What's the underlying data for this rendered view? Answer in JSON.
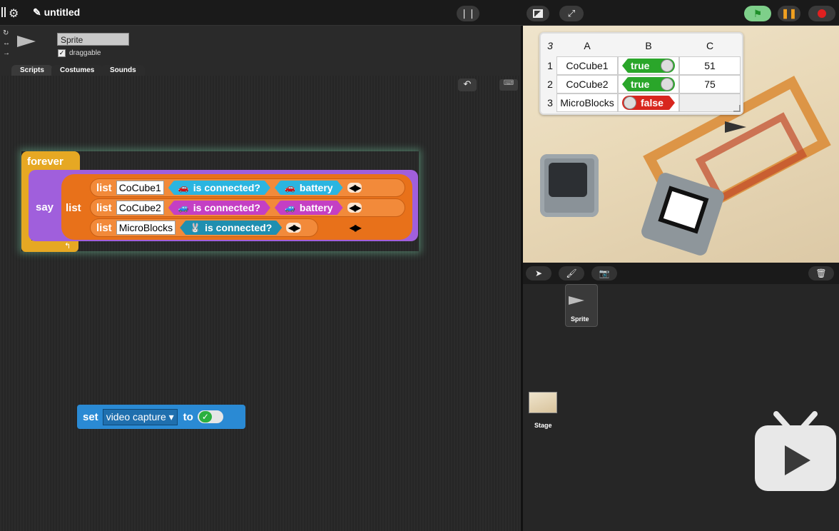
{
  "app": {
    "project_title": "✎ untitled"
  },
  "sprite": {
    "name": "Sprite",
    "draggable_label": "draggable",
    "draggable_checked": "✓"
  },
  "tabs": [
    {
      "label": "Scripts"
    },
    {
      "label": "Costumes"
    },
    {
      "label": "Sounds"
    }
  ],
  "blocks": {
    "forever_label": "forever",
    "say_label": "say",
    "list_label": "list",
    "rows": [
      {
        "label": "list",
        "name": "CoCube1",
        "pred": "is connected?",
        "reporter": "battery",
        "arrows": "◀▶"
      },
      {
        "label": "list",
        "name": "CoCube2",
        "pred": "is connected?",
        "reporter": "battery",
        "arrows": "◀▶"
      },
      {
        "label": "list",
        "name": "MicroBlocks",
        "pred": "is connected?",
        "arrows": "◀▶"
      }
    ],
    "outer_arrows": "◀▶",
    "set_label": "set",
    "set_var": "video capture",
    "to_label": "to",
    "toggle_check": "✓"
  },
  "table": {
    "corner": "3",
    "headers": [
      "A",
      "B",
      "C"
    ],
    "rows": [
      {
        "index": "1",
        "a": "CoCube1",
        "b": "true",
        "c": "51"
      },
      {
        "index": "2",
        "a": "CoCube2",
        "b": "true",
        "c": "75"
      },
      {
        "index": "3",
        "a": "MicroBlocks",
        "b": "false",
        "c": ""
      }
    ]
  },
  "corral": {
    "sprite_label": "Sprite",
    "stage_label": "Stage"
  },
  "icons": {
    "settings": "gear-icon",
    "flag": "green-flag-icon",
    "pause": "pause-icon",
    "stop": "stop-icon",
    "trash": "trash-icon"
  },
  "colors": {
    "control": "#e6a823",
    "looks": "#a05fdc",
    "lists": "#e8711a",
    "variables": "#2a8ad4",
    "true": "#2aa62a",
    "false": "#d8261e"
  }
}
